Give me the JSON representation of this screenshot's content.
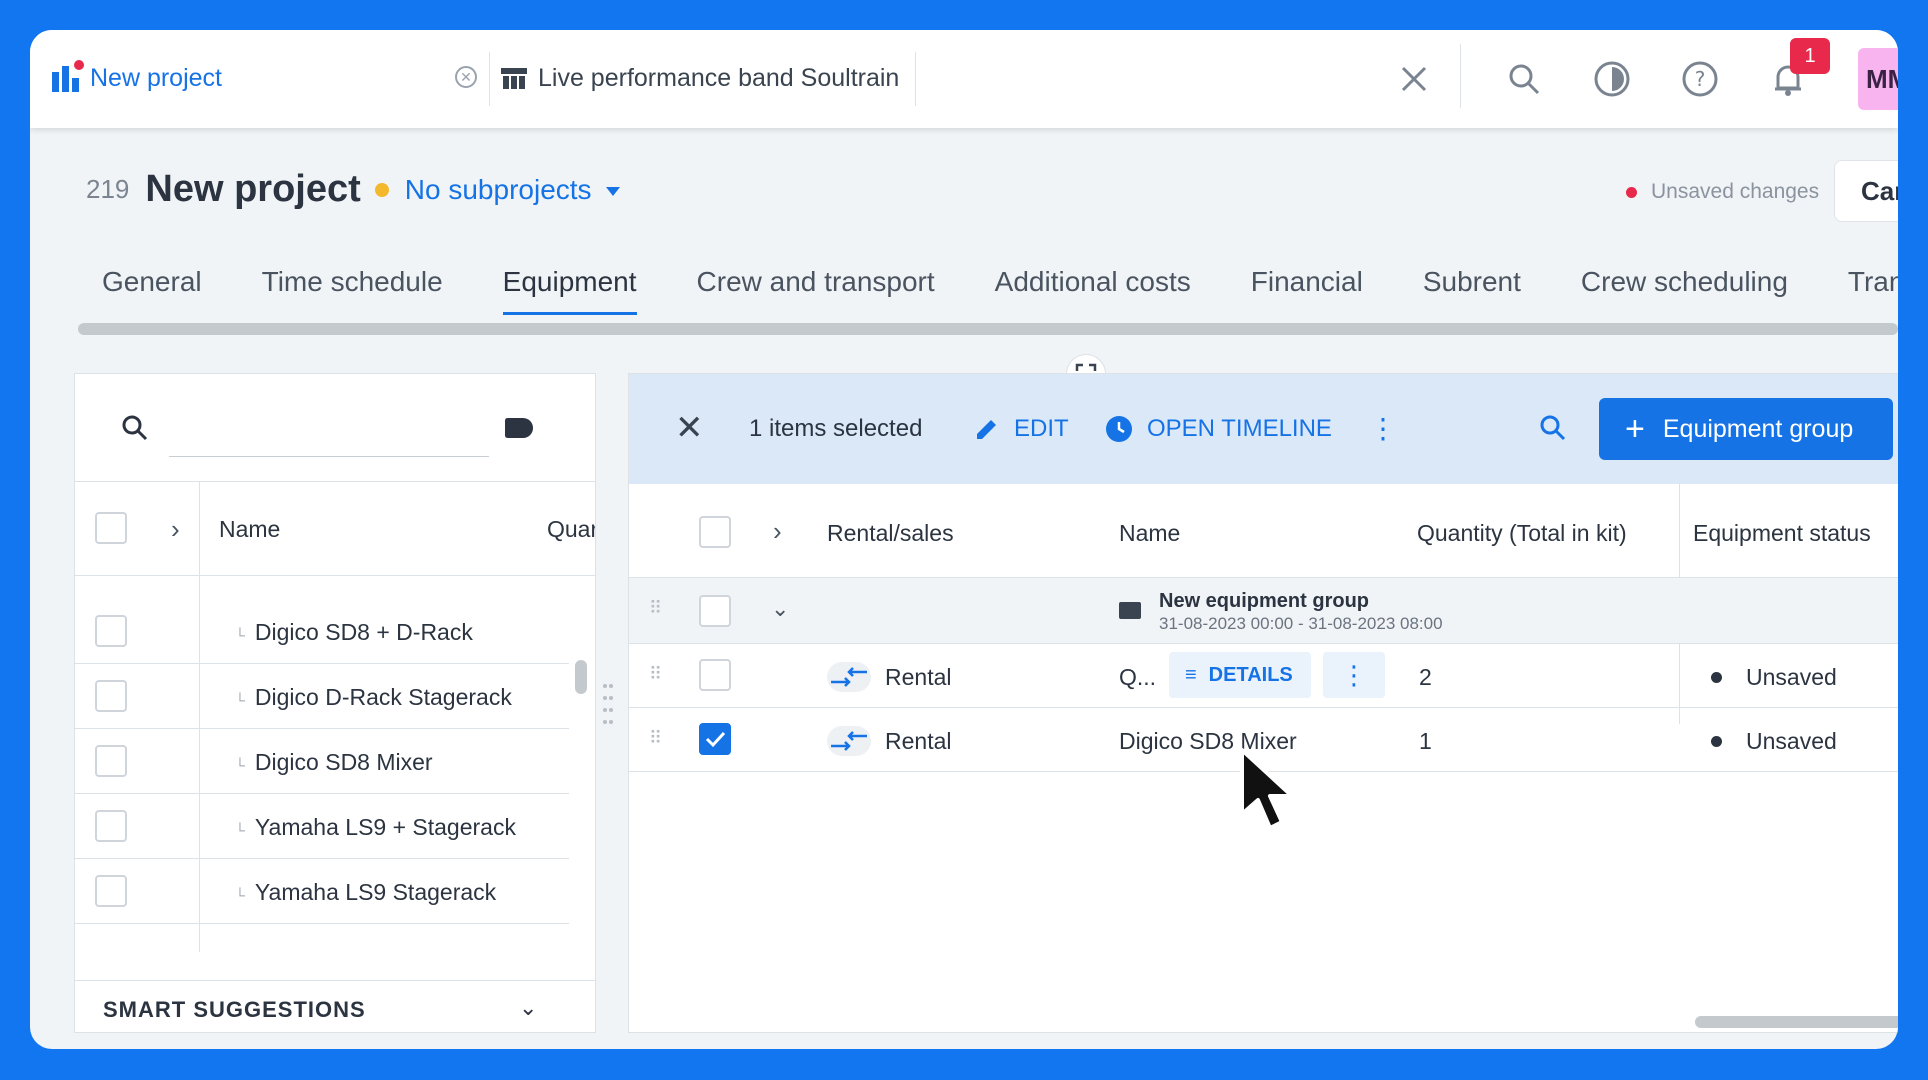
{
  "topbar": {
    "project_tab": "New project",
    "second_tab": "Live performance band Soultrain",
    "notifications_count": "1",
    "avatar_initials": "MM"
  },
  "header": {
    "project_number": "219",
    "project_title": "New project",
    "subprojects": "No subprojects",
    "unsaved_label": "Unsaved changes",
    "cancel_label": "Car"
  },
  "tabs": [
    "General",
    "Time schedule",
    "Equipment",
    "Crew and transport",
    "Additional costs",
    "Financial",
    "Subrent",
    "Crew scheduling",
    "Tran"
  ],
  "left_panel": {
    "col_name": "Name",
    "col_qty": "Quar",
    "rows": [
      "Digico SD8 + D-Rack",
      "Digico D-Rack Stagerack",
      "Digico SD8 Mixer",
      "Yamaha LS9 + Stagerack",
      "Yamaha LS9 Stagerack"
    ],
    "smart_suggestions": "SMART SUGGESTIONS"
  },
  "right_panel": {
    "selected_text": "1 items selected",
    "edit_label": "EDIT",
    "timeline_label": "OPEN TIMELINE",
    "add_button": "Equipment group",
    "columns": {
      "rental_sales": "Rental/sales",
      "name": "Name",
      "quantity": "Quantity (Total in kit)",
      "status": "Equipment status"
    },
    "group": {
      "name": "New equipment group",
      "dates": "31-08-2023 00:00 - 31-08-2023 08:00"
    },
    "rows": [
      {
        "type": "Rental",
        "name": "Q...",
        "qty": "2",
        "status": "Unsaved",
        "checked": false
      },
      {
        "type": "Rental",
        "name": "Digico SD8 Mixer",
        "qty": "1",
        "status": "Unsaved",
        "checked": true
      }
    ],
    "details_label": "DETAILS"
  },
  "colors": {
    "accent": "#1573e6",
    "frame": "#1176f0",
    "badge": "#e8294c",
    "status_dot": "#f3b82b"
  }
}
